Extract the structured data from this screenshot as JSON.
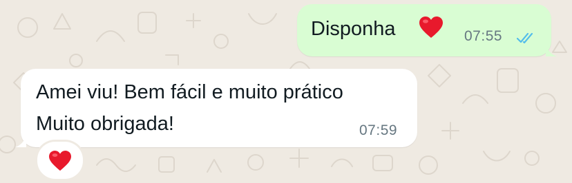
{
  "chat": {
    "outgoing": {
      "text": "Disponha",
      "emoji": "heart-emoji",
      "time": "07:55",
      "status": "read",
      "status_color": "#53bdeb"
    },
    "incoming": {
      "line1": "Amei viu! Bem fácil e muito prático",
      "line2": "Muito obrigada!",
      "time": "07:59"
    },
    "reaction": {
      "emoji": "heart-emoji"
    }
  },
  "colors": {
    "background": "#efeae2",
    "outgoing_bubble": "#d9fdd3",
    "incoming_bubble": "#ffffff",
    "heart": "#e8192c"
  }
}
